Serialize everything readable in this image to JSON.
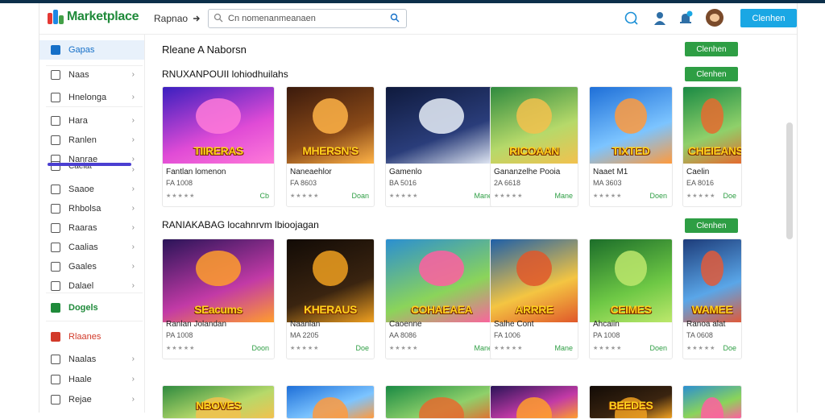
{
  "header": {
    "brand": "Marketplace",
    "nav_link": "Rapnao",
    "search_value": "Cn nomenanmeanaen",
    "cta_label": "Clenhen"
  },
  "sidebar": {
    "items": [
      {
        "label": "Gapas",
        "icon": "store-icon",
        "state": "active",
        "chevron": false
      },
      {
        "label": "Naas",
        "icon": "grid-icon",
        "state": "",
        "chevron": true
      },
      {
        "label": "Hnelonga",
        "icon": "list-icon",
        "state": "",
        "chevron": true
      },
      {
        "label": "Hara",
        "icon": "page-icon",
        "state": "",
        "chevron": true
      },
      {
        "label": "Ranlen",
        "icon": "shield-icon",
        "state": "",
        "chevron": true
      },
      {
        "label": "Nanrae",
        "icon": "cart-icon",
        "state": "",
        "chevron": true
      },
      {
        "label": "Caelat",
        "icon": "tag-icon",
        "state": "",
        "chevron": true
      },
      {
        "label": "Saaoe",
        "icon": "save-icon",
        "state": "",
        "chevron": true
      },
      {
        "label": "Rhbolsa",
        "icon": "folder-icon",
        "state": "",
        "chevron": true
      },
      {
        "label": "Raaras",
        "icon": "file-icon",
        "state": "",
        "chevron": true
      },
      {
        "label": "Caalias",
        "icon": "chat-icon",
        "state": "",
        "chevron": true
      },
      {
        "label": "Gaales",
        "icon": "heart-icon",
        "state": "",
        "chevron": true
      },
      {
        "label": "Dalael",
        "icon": "video-icon",
        "state": "",
        "chevron": true
      },
      {
        "label": "Dogels",
        "icon": "gift-icon",
        "state": "green",
        "chevron": false
      },
      {
        "label": "Rlaanes",
        "icon": "sale-icon",
        "state": "red",
        "chevron": false
      },
      {
        "label": "Naalas",
        "icon": "calendar-icon",
        "state": "",
        "chevron": true
      },
      {
        "label": "Haale",
        "icon": "pen-icon",
        "state": "",
        "chevron": true
      },
      {
        "label": "Rejae",
        "icon": "help-icon",
        "state": "",
        "chevron": true
      }
    ]
  },
  "sections": [
    {
      "title": "Rleane A Naborsn",
      "button": "Clenhen"
    },
    {
      "title": "RNUXANPOUII lohiodhuilahs",
      "button": "Clenhen"
    },
    {
      "title": "RANIAKABAG locahnrvm lbioojagan",
      "button": "Clenhen"
    }
  ],
  "row1": [
    {
      "art": "TIIRERAS",
      "name": "Fantlan lomenon",
      "sub": "FA 1008",
      "stars": "★★★★★",
      "price": "Cb"
    },
    {
      "art": "MHERSN'S",
      "name": "Naneaehlor",
      "sub": "FA 8603",
      "stars": "★★★★★",
      "price": "Doan"
    },
    {
      "art": "",
      "name": "Gamenlo",
      "sub": "BA 5016",
      "stars": "★★★★★",
      "price": "Mane"
    },
    {
      "art": "RICOAAN",
      "name": "Gananzelhe Pooia",
      "sub": "2A 6618",
      "stars": "★★★★★",
      "price": "Mane"
    },
    {
      "art": "TIXTED",
      "name": "Naaet M1",
      "sub": "MA 3603",
      "stars": "★★★★★",
      "price": "Doen"
    },
    {
      "art": "CHEIEANS",
      "name": "Caelin",
      "sub": "EA 8016",
      "stars": "★★★★★",
      "price": "Doe"
    }
  ],
  "row2": [
    {
      "art": "SEacums",
      "name": "Ranlan Jolandan",
      "sub": "PA 1008",
      "stars": "★★★★★",
      "price": "Doon"
    },
    {
      "art": "KHERAUS",
      "name": "Naanlan",
      "sub": "MA 2205",
      "stars": "★★★★★",
      "price": "Doe"
    },
    {
      "art": "COHAEAEA",
      "name": "Caoenne",
      "sub": "AA 8086",
      "stars": "★★★★★",
      "price": "Mane"
    },
    {
      "art": "ARRRE",
      "name": "Salhe Cont",
      "sub": "FA 1006",
      "stars": "★★★★★",
      "price": "Mane"
    },
    {
      "art": "CEIMES",
      "name": "Ahcaiin",
      "sub": "PA 1008",
      "stars": "★★★★★",
      "price": "Doen"
    },
    {
      "art": "WAMEE",
      "name": "Ranoa alat",
      "sub": "TA 0608",
      "stars": "★★★★★",
      "price": "Doe"
    }
  ],
  "row3": [
    {
      "art": "NBOVES"
    },
    {
      "art": ""
    },
    {
      "art": ""
    },
    {
      "art": ""
    },
    {
      "art": "BEEDES"
    },
    {
      "art": ""
    }
  ]
}
